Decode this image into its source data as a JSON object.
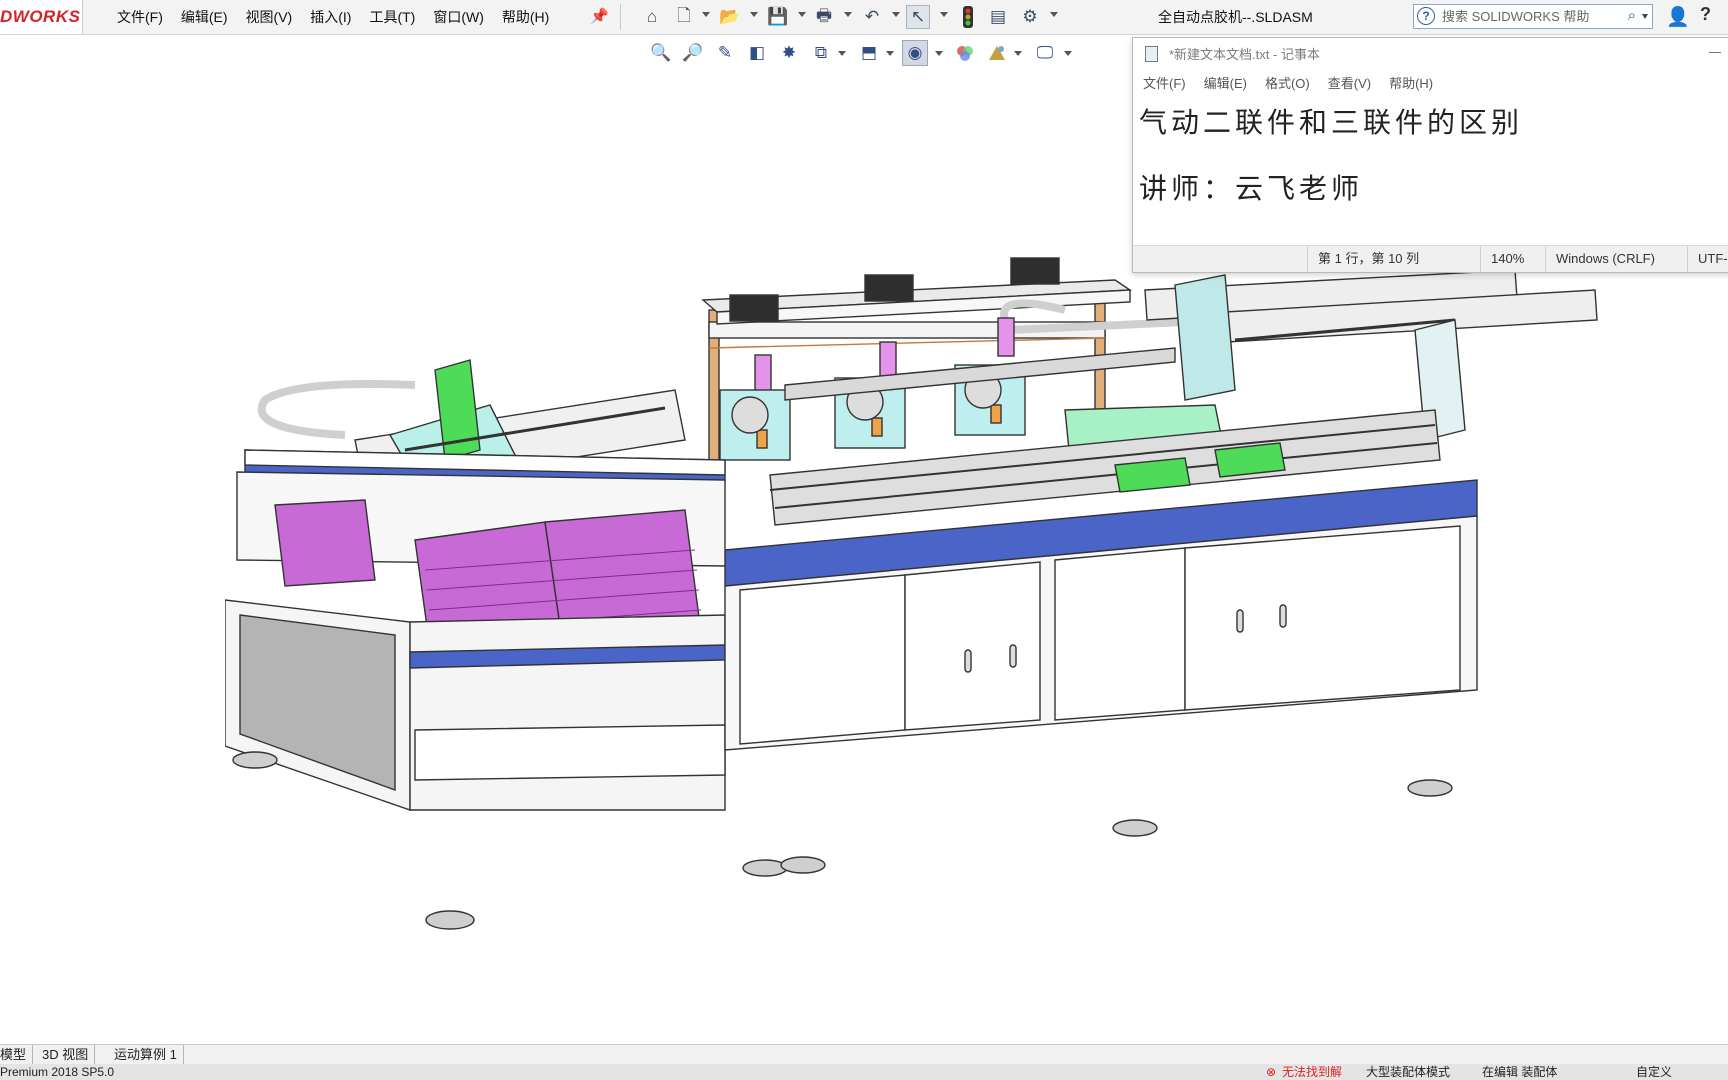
{
  "app": {
    "logo_text": "DWORKS",
    "document_title": "全自动点胶机--.SLDASM"
  },
  "menu": {
    "items": [
      "文件(F)",
      "编辑(E)",
      "视图(V)",
      "插入(I)",
      "工具(T)",
      "窗口(W)",
      "帮助(H)"
    ]
  },
  "search": {
    "placeholder": "搜索 SOLIDWORKS 帮助"
  },
  "notepad": {
    "title": "*新建文本文档.txt - 记事本",
    "menu": [
      "文件(F)",
      "编辑(E)",
      "格式(O)",
      "查看(V)",
      "帮助(H)"
    ],
    "lines": [
      "气动二联件和三联件的区别",
      "讲师：云飞老师"
    ],
    "status": {
      "position": "第 1 行，第 10 列",
      "zoom": "140%",
      "line_ending": "Windows (CRLF)",
      "encoding": "UTF-"
    }
  },
  "bottom_tabs": [
    "模型",
    "3D 视图",
    "运动算例 1"
  ],
  "statusbar": {
    "version": "Premium 2018 SP5.0",
    "error": "无法找到解",
    "mode": "大型装配体模式",
    "editing": "在编辑 装配体",
    "custom": "自定义"
  },
  "colors": {
    "solidworks_red": "#d3242a",
    "frame_blue": "#4a64c8",
    "bin_magenta": "#c86ad6",
    "accent_green": "#3fd46a",
    "bracket_cyan": "#7fe0e0"
  }
}
